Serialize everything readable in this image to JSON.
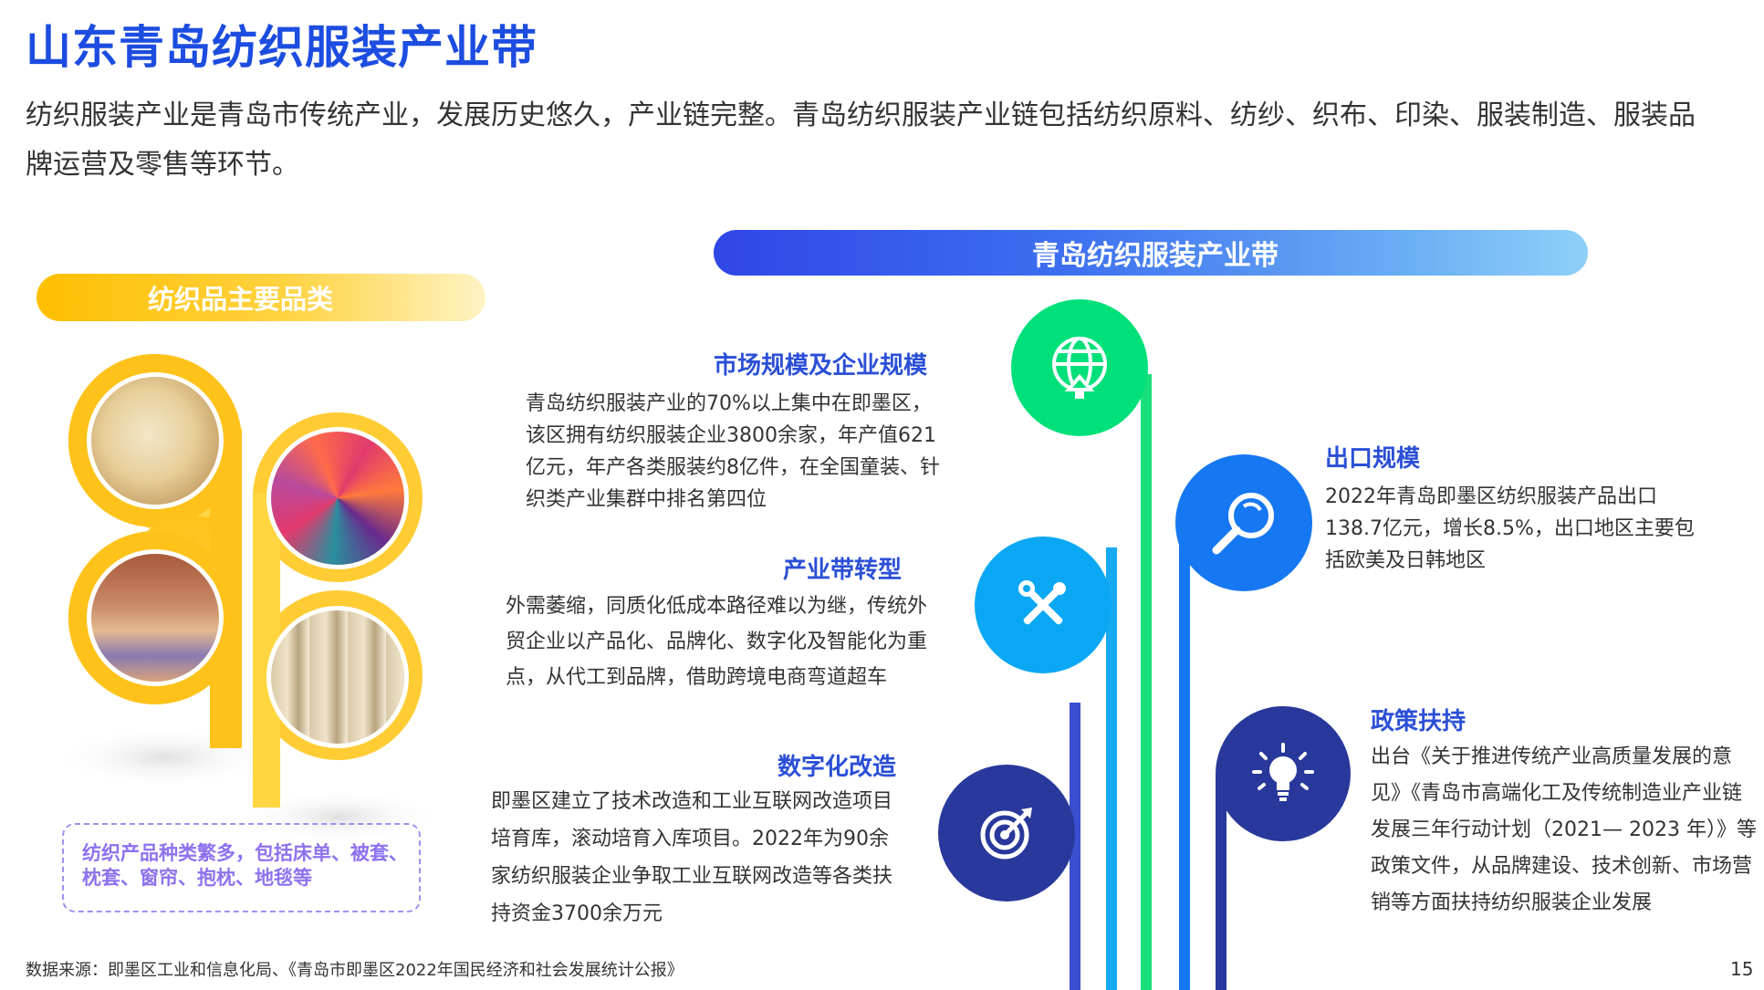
{
  "title": "山东青岛纺织服装产业带",
  "intro": "纺织服装产业是青岛市传统产业，发展历史悠久，产业链完整。青岛纺织服装产业链包括纺织原料、纺纱、织布、印染、服装制造、服装品牌运营及零售等环节。",
  "left_banner": "纺织品主要品类",
  "right_banner": "青岛纺织服装产业带",
  "category_summary": "纺织产品种类繁多，包括床单、被套、枕套、窗帘、抱枕、地毯等",
  "sections": {
    "market": {
      "title": "市场规模及企业规模",
      "body": "青岛纺织服装产业的70%以上集中在即墨区，该区拥有纺织服装企业3800余家，年产值621亿元，年产各类服装约8亿件，在全国童装、针织类产业集群中排名第四位"
    },
    "transform": {
      "title": "产业带转型",
      "body": "外需萎缩，同质化低成本路径难以为继，传统外贸企业以产品化、品牌化、数字化及智能化为重点，从代工到品牌，借助跨境电商弯道超车"
    },
    "digital": {
      "title": "数字化改造",
      "body": "即墨区建立了技术改造和工业互联网改造项目培育库，滚动培育入库项目。2022年为90余家纺织服装企业争取工业互联网改造等各类扶持资金3700余万元"
    },
    "export": {
      "title": "出口规模",
      "body": "2022年青岛即墨区纺织服装产品出口138.7亿元，增长8.5%，出口地区主要包括欧美及日韩地区"
    },
    "policy": {
      "title": "政策扶持",
      "body": "出台《关于推进传统产业高质量发展的意见》《青岛市高端化工及传统制造业产业链发展三年行动计划（2021— 2023 年）》等政策文件，从品牌建设、技术创新、市场营销等方面扶持纺织服装企业发展"
    }
  },
  "icons": {
    "market": "globe-upload-icon",
    "transform": "tools-icon",
    "digital": "target-icon",
    "export": "magnifier-icon",
    "policy": "lightbulb-icon"
  },
  "colors": {
    "title": "#1c4de0",
    "green": "#00e07a",
    "sky": "#0aa8f4",
    "blue": "#1677f2",
    "navy": "#28389b",
    "yellow": "#ffbf00",
    "purple": "#8d72ee"
  },
  "footer": {
    "source": "数据来源：即墨区工业和信息化局、《青岛市即墨区2022年国民经济和社会发展统计公报》",
    "page": "15"
  }
}
